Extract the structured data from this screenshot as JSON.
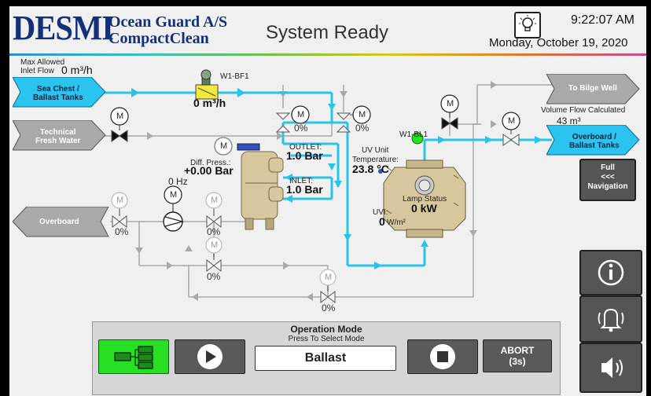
{
  "header": {
    "logo_main": "DESMI",
    "logo_sub1": "Ocean Guard A/S",
    "logo_sub2": "CompactClean",
    "status": "System Ready",
    "time": "9:22:07 AM",
    "date": "Monday, October 19, 2020"
  },
  "inlet": {
    "max_label_1": "Max Allowed",
    "max_label_2": "Inlet Flow",
    "max_value": "0 m³/h",
    "flow_value": "0 m³/h",
    "flowmeter_tag": "W1-BF1"
  },
  "nodes": {
    "sea_chest_1": "Sea Chest /",
    "sea_chest_2": "Ballast Tanks",
    "fresh_water_1": "Technical",
    "fresh_water_2": "Fresh Water",
    "overboard_left": "Overboard",
    "to_bilge": "To Bilge Well",
    "overboard_right_1": "Overboard /",
    "overboard_right_2": "Ballast Tanks"
  },
  "motor_label": "M",
  "valves": {
    "v1": "0%",
    "v2": "0%",
    "v3": "0%",
    "v4": "0%",
    "v5": "0%",
    "v6": "0%",
    "v7": "0%"
  },
  "filter": {
    "diff_label": "Diff. Press.:",
    "diff_value": "+0.00 Bar",
    "outlet_label": "OUTLET:",
    "outlet_value": "1.0 Bar",
    "inlet_label": "INLET:",
    "inlet_value": "1.0 Bar"
  },
  "pump": {
    "freq": "0 Hz"
  },
  "uv": {
    "temp_label_1": "UV Unit",
    "temp_label_2": "Temperature:",
    "temp_value": "23.8 °C",
    "sensor_tag": "W1-BL1",
    "lamp_label": "Lamp Status",
    "lamp_value": "0 kW",
    "uvi_label": "UVI:",
    "uvi_value": "0",
    "uvi_unit": "W/m²"
  },
  "volume": {
    "label": "Volume Flow Calculated",
    "value": "43 m³"
  },
  "side": {
    "nav_1": "Full",
    "nav_2": "<<<",
    "nav_3": "Navigation",
    "info_icon": "info-icon",
    "alarm_icon": "bell-icon",
    "sound_icon": "speaker-icon"
  },
  "operation": {
    "title": "Operation Mode",
    "subtitle": "Press To Select Mode",
    "mode": "Ballast",
    "abort_1": "ABORT",
    "abort_2": "(3s)"
  },
  "colors": {
    "water": "#27c4e8",
    "idle_pipe": "#a8a8a8",
    "arrow_blue": "#27c4e8",
    "active_green": "#27e024",
    "node_blue": "#2bc4f0",
    "node_grey": "#a9a9a9"
  }
}
